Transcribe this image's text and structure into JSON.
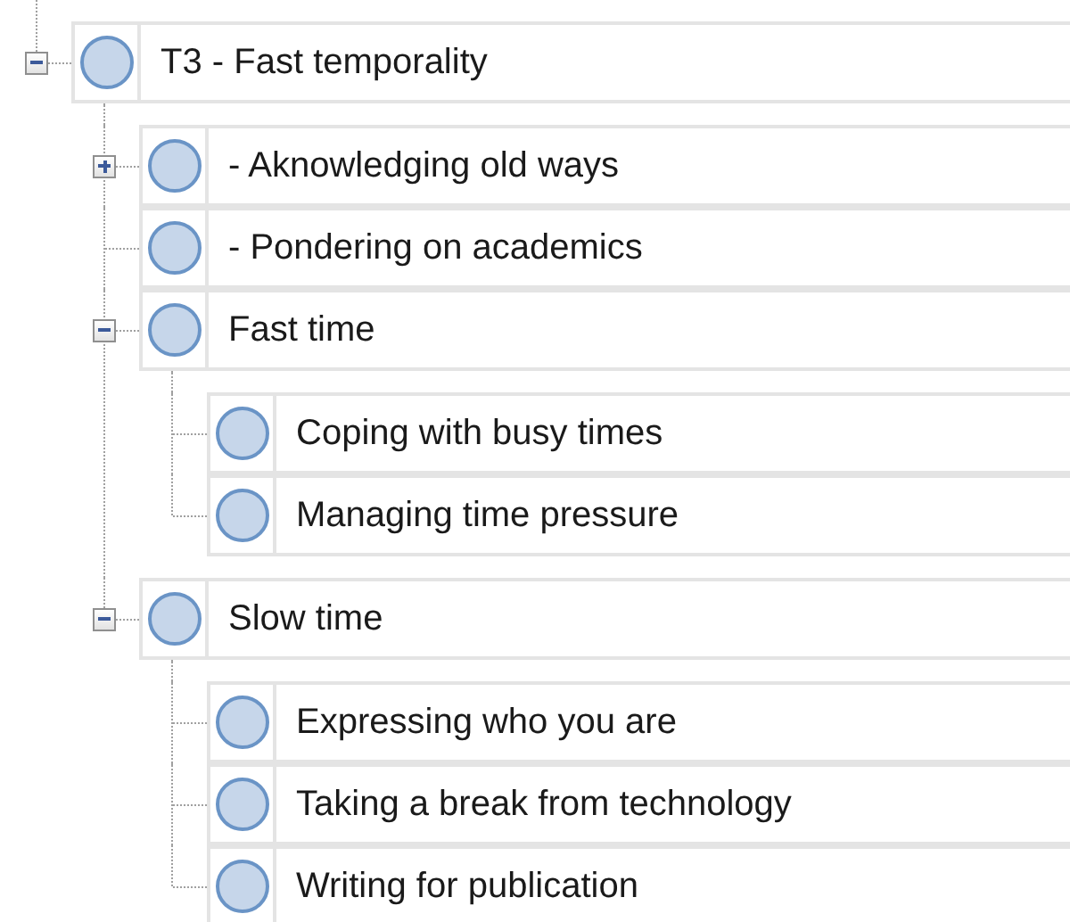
{
  "tree": {
    "nodes": [
      {
        "label": "T3 - Fast temporality",
        "expanded": true,
        "children": [
          {
            "label": "- Aknowledging old ways",
            "expanded": false
          },
          {
            "label": "- Pondering on academics"
          },
          {
            "label": "Fast time",
            "expanded": true,
            "children": [
              {
                "label": "Coping with busy times"
              },
              {
                "label": "Managing time pressure"
              }
            ]
          },
          {
            "label": "Slow time",
            "expanded": true,
            "children": [
              {
                "label": "Expressing who you are"
              },
              {
                "label": "Taking a break from technology"
              },
              {
                "label": "Writing for publication"
              }
            ]
          }
        ]
      }
    ]
  }
}
